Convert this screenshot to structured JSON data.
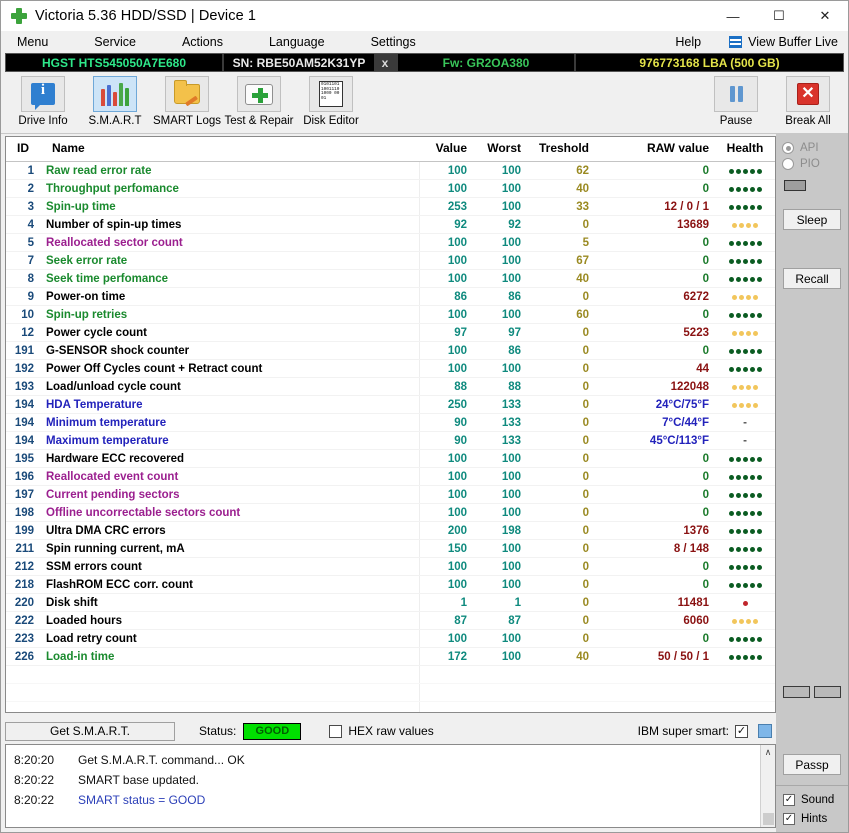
{
  "window": {
    "title": "Victoria 5.36 HDD/SSD | Device 1",
    "app_icon": "green-cross-icon",
    "minimize": "—",
    "maximize": "☐",
    "close": "✕"
  },
  "menubar": {
    "items": [
      "Menu",
      "Service",
      "Actions",
      "Language",
      "Settings"
    ],
    "help": "Help",
    "view_buffer_live": "View Buffer Live"
  },
  "drivebar": {
    "model": "HGST HTS545050A7E680",
    "serial": "SN: RBE50AM52K31YP",
    "x_button": "x",
    "firmware": "Fw: GR2OA380",
    "capacity": "976773168 LBA (500 GB)"
  },
  "toolbar": {
    "buttons": [
      {
        "label": "Drive Info",
        "icon": "info-bubble-icon",
        "active": false
      },
      {
        "label": "S.M.A.R.T",
        "icon": "test-tubes-icon",
        "active": true
      },
      {
        "label": "SMART Logs",
        "icon": "folder-pencil-icon",
        "active": false
      },
      {
        "label": "Test & Repair",
        "icon": "first-aid-kit-icon",
        "active": false
      },
      {
        "label": "Disk Editor",
        "icon": "binary-page-icon",
        "active": false
      }
    ],
    "right_buttons": [
      {
        "label": "Pause",
        "icon": "pause-icon"
      },
      {
        "label": "Break All",
        "icon": "red-x-icon"
      }
    ]
  },
  "table": {
    "headers": [
      "ID",
      "Name",
      "Value",
      "Worst",
      "Treshold",
      "RAW value",
      "Health"
    ],
    "rows": [
      {
        "id": "1",
        "name": "Raw read error rate",
        "name_color": "green",
        "value": "100",
        "worst": "100",
        "threshold": "62",
        "raw": "0",
        "raw_zero": true,
        "health": "ggggg"
      },
      {
        "id": "2",
        "name": "Throughput perfomance",
        "name_color": "green",
        "value": "100",
        "worst": "100",
        "threshold": "40",
        "raw": "0",
        "raw_zero": true,
        "health": "ggggg"
      },
      {
        "id": "3",
        "name": "Spin-up time",
        "name_color": "green",
        "value": "253",
        "worst": "100",
        "threshold": "33",
        "raw": "12 / 0 / 1",
        "raw_zero": false,
        "health": "ggggg"
      },
      {
        "id": "4",
        "name": "Number of spin-up times",
        "name_color": "black",
        "value": "92",
        "worst": "92",
        "threshold": "0",
        "raw": "13689",
        "raw_zero": false,
        "health": "yyyy"
      },
      {
        "id": "5",
        "name": "Reallocated sector count",
        "name_color": "purple",
        "value": "100",
        "worst": "100",
        "threshold": "5",
        "raw": "0",
        "raw_zero": true,
        "health": "ggggg"
      },
      {
        "id": "7",
        "name": "Seek error rate",
        "name_color": "green",
        "value": "100",
        "worst": "100",
        "threshold": "67",
        "raw": "0",
        "raw_zero": true,
        "health": "ggggg"
      },
      {
        "id": "8",
        "name": "Seek time perfomance",
        "name_color": "green",
        "value": "100",
        "worst": "100",
        "threshold": "40",
        "raw": "0",
        "raw_zero": true,
        "health": "ggggg"
      },
      {
        "id": "9",
        "name": "Power-on time",
        "name_color": "black",
        "value": "86",
        "worst": "86",
        "threshold": "0",
        "raw": "6272",
        "raw_zero": false,
        "health": "yyyy"
      },
      {
        "id": "10",
        "name": "Spin-up retries",
        "name_color": "green",
        "value": "100",
        "worst": "100",
        "threshold": "60",
        "raw": "0",
        "raw_zero": true,
        "health": "ggggg"
      },
      {
        "id": "12",
        "name": "Power cycle count",
        "name_color": "black",
        "value": "97",
        "worst": "97",
        "threshold": "0",
        "raw": "5223",
        "raw_zero": false,
        "health": "yyyy"
      },
      {
        "id": "191",
        "name": "G-SENSOR shock counter",
        "name_color": "black",
        "value": "100",
        "worst": "86",
        "threshold": "0",
        "raw": "0",
        "raw_zero": true,
        "health": "ggggg"
      },
      {
        "id": "192",
        "name": "Power Off Cycles count + Retract count",
        "name_color": "black",
        "value": "100",
        "worst": "100",
        "threshold": "0",
        "raw": "44",
        "raw_zero": false,
        "health": "ggggg"
      },
      {
        "id": "193",
        "name": "Load/unload cycle count",
        "name_color": "black",
        "value": "88",
        "worst": "88",
        "threshold": "0",
        "raw": "122048",
        "raw_zero": false,
        "health": "yyyy"
      },
      {
        "id": "194",
        "name": "HDA Temperature",
        "name_color": "blue",
        "value": "250",
        "worst": "133",
        "threshold": "0",
        "raw": "24°C/75°F",
        "raw_zero": false,
        "raw_color": "blue",
        "health": "yyyy"
      },
      {
        "id": "194",
        "name": "Minimum temperature",
        "name_color": "blue",
        "value": "90",
        "worst": "133",
        "threshold": "0",
        "raw": "7°C/44°F",
        "raw_zero": false,
        "raw_color": "blue",
        "health": "dash"
      },
      {
        "id": "194",
        "name": "Maximum temperature",
        "name_color": "blue",
        "value": "90",
        "worst": "133",
        "threshold": "0",
        "raw": "45°C/113°F",
        "raw_zero": false,
        "raw_color": "blue",
        "health": "dash"
      },
      {
        "id": "195",
        "name": "Hardware ECC recovered",
        "name_color": "black",
        "value": "100",
        "worst": "100",
        "threshold": "0",
        "raw": "0",
        "raw_zero": true,
        "health": "ggggg"
      },
      {
        "id": "196",
        "name": "Reallocated event count",
        "name_color": "purple",
        "value": "100",
        "worst": "100",
        "threshold": "0",
        "raw": "0",
        "raw_zero": true,
        "health": "ggggg"
      },
      {
        "id": "197",
        "name": "Current pending sectors",
        "name_color": "purple",
        "value": "100",
        "worst": "100",
        "threshold": "0",
        "raw": "0",
        "raw_zero": true,
        "health": "ggggg"
      },
      {
        "id": "198",
        "name": "Offline uncorrectable sectors count",
        "name_color": "purple",
        "value": "100",
        "worst": "100",
        "threshold": "0",
        "raw": "0",
        "raw_zero": true,
        "health": "ggggg"
      },
      {
        "id": "199",
        "name": "Ultra DMA CRC errors",
        "name_color": "black",
        "value": "200",
        "worst": "198",
        "threshold": "0",
        "raw": "1376",
        "raw_zero": false,
        "health": "ggggg"
      },
      {
        "id": "211",
        "name": "Spin running current, mA",
        "name_color": "black",
        "value": "150",
        "worst": "100",
        "threshold": "0",
        "raw": "8 / 148",
        "raw_zero": false,
        "health": "ggggg"
      },
      {
        "id": "212",
        "name": "SSM errors count",
        "name_color": "black",
        "value": "100",
        "worst": "100",
        "threshold": "0",
        "raw": "0",
        "raw_zero": true,
        "health": "ggggg"
      },
      {
        "id": "218",
        "name": "FlashROM ECC corr. count",
        "name_color": "black",
        "value": "100",
        "worst": "100",
        "threshold": "0",
        "raw": "0",
        "raw_zero": true,
        "health": "ggggg"
      },
      {
        "id": "220",
        "name": "Disk shift",
        "name_color": "black",
        "value": "1",
        "worst": "1",
        "threshold": "0",
        "raw": "11481",
        "raw_zero": false,
        "health": "r"
      },
      {
        "id": "222",
        "name": "Loaded hours",
        "name_color": "black",
        "value": "87",
        "worst": "87",
        "threshold": "0",
        "raw": "6060",
        "raw_zero": false,
        "health": "yyyy"
      },
      {
        "id": "223",
        "name": "Load retry count",
        "name_color": "black",
        "value": "100",
        "worst": "100",
        "threshold": "0",
        "raw": "0",
        "raw_zero": true,
        "health": "ggggg"
      },
      {
        "id": "226",
        "name": "Load-in time",
        "name_color": "green",
        "value": "172",
        "worst": "100",
        "threshold": "40",
        "raw": "50 / 50 / 1",
        "raw_zero": false,
        "health": "ggggg"
      }
    ]
  },
  "statusbar": {
    "get_smart_label": "Get S.M.A.R.T.",
    "status_label": "Status:",
    "status_value": "GOOD",
    "hex_raw_label": "HEX raw values",
    "hex_raw_checked": false,
    "ibm_super_label": "IBM super smart:",
    "ibm_super_checked": true,
    "ibm_super_mark": "✓",
    "blue_square": "color-swatch"
  },
  "log": {
    "lines": [
      {
        "time": "8:20:20",
        "msg": "Get S.M.A.R.T. command... OK",
        "color": "black"
      },
      {
        "time": "8:20:22",
        "msg": "SMART base updated.",
        "color": "black"
      },
      {
        "time": "8:20:22",
        "msg": "SMART status = GOOD",
        "color": "blue"
      }
    ],
    "scroll_up": "∧"
  },
  "right_panel": {
    "api_label": "API",
    "pio_label": "PIO",
    "api_selected": true,
    "pio_selected": false,
    "sleep_label": "Sleep",
    "recall_label": "Recall",
    "passp_label": "Passp",
    "small_left": "",
    "small_right": "",
    "sound_label": "Sound",
    "sound_checked": true,
    "hints_label": "Hints",
    "hints_checked": true,
    "check_mark": "✓"
  },
  "colors": {
    "green_name": "#1a8a2e",
    "purple_name": "#9b1f8f",
    "blue_name": "#2222bb",
    "black_name": "#000000",
    "value_teal": "#0f8a7e",
    "threshold_olive": "#9a8a22",
    "raw_red": "#8a1212",
    "raw_green": "#1a7a2a",
    "health_good": "#0b5c22",
    "health_warn": "#f2c65c",
    "health_bad": "#c0262c",
    "status_good_bg": "#00e000",
    "drive_model_green": "#2ee88a",
    "drive_fw_green": "#39c65a",
    "drive_lba_yellow": "#e3e34a"
  }
}
